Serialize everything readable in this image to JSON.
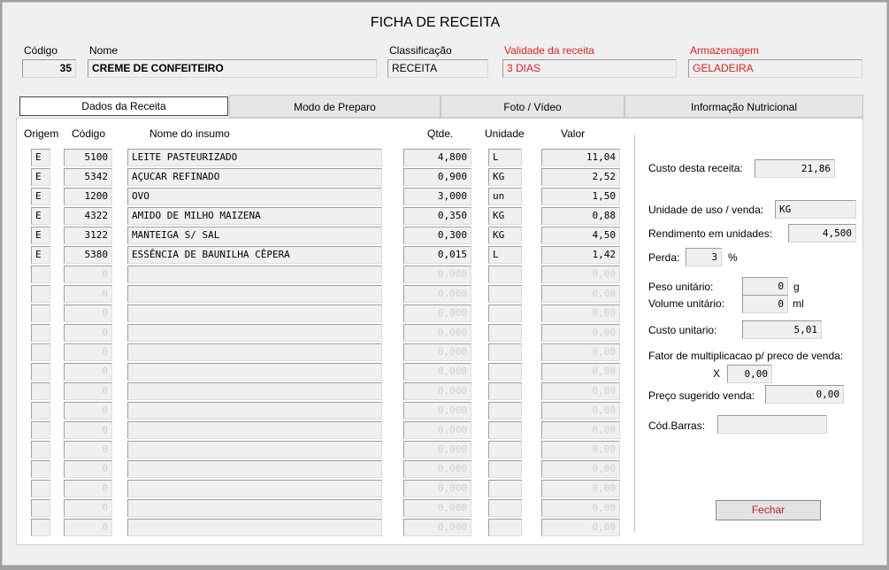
{
  "title": "FICHA DE RECEITA",
  "header": {
    "codigo_label": "Código",
    "codigo_value": "35",
    "nome_label": "Nome",
    "nome_value": "CREME DE CONFEITEIRO",
    "classificacao_label": "Classificação",
    "classificacao_value": "RECEITA",
    "validade_label": "Validade da receita",
    "validade_value": "3 DIAS",
    "armazenagem_label": "Armazenagem",
    "armazenagem_value": "GELADEIRA",
    "accent_color": "#e02020"
  },
  "tabs": [
    {
      "label": "Dados da Receita",
      "active": true
    },
    {
      "label": "Modo de Preparo",
      "active": false
    },
    {
      "label": "Foto / Vídeo",
      "active": false
    },
    {
      "label": "Informação Nutricional",
      "active": false
    }
  ],
  "table": {
    "columns": [
      "Origem",
      "Código",
      "Nome do insumo",
      "Qtde.",
      "Unidade",
      "Valor"
    ],
    "rows": [
      {
        "origem": "E",
        "codigo": "5100",
        "nome": "LEITE PASTEURIZADO",
        "qtde": "4,800",
        "unidade": "L",
        "valor": "11,04"
      },
      {
        "origem": "E",
        "codigo": "5342",
        "nome": "AÇUCAR REFINADO",
        "qtde": "0,900",
        "unidade": "KG",
        "valor": "2,52"
      },
      {
        "origem": "E",
        "codigo": "1200",
        "nome": "OVO",
        "qtde": "3,000",
        "unidade": "un",
        "valor": "1,50"
      },
      {
        "origem": "E",
        "codigo": "4322",
        "nome": "AMIDO DE MILHO MAIZENA",
        "qtde": "0,350",
        "unidade": "KG",
        "valor": "0,88"
      },
      {
        "origem": "E",
        "codigo": "3122",
        "nome": "MANTEIGA S/ SAL",
        "qtde": "0,300",
        "unidade": "KG",
        "valor": "4,50"
      },
      {
        "origem": "E",
        "codigo": "5380",
        "nome": "ESSÊNCIA DE BAUNILHA CÊPERA",
        "qtde": "0,015",
        "unidade": "L",
        "valor": "1,42"
      },
      {
        "origem": "",
        "codigo": "0",
        "nome": "",
        "qtde": "0,000",
        "unidade": "",
        "valor": "0,00"
      },
      {
        "origem": "",
        "codigo": "0",
        "nome": "",
        "qtde": "0,000",
        "unidade": "",
        "valor": "0,00"
      },
      {
        "origem": "",
        "codigo": "0",
        "nome": "",
        "qtde": "0,000",
        "unidade": "",
        "valor": "0,00"
      },
      {
        "origem": "",
        "codigo": "0",
        "nome": "",
        "qtde": "0,000",
        "unidade": "",
        "valor": "0,00"
      },
      {
        "origem": "",
        "codigo": "0",
        "nome": "",
        "qtde": "0,000",
        "unidade": "",
        "valor": "0,00"
      },
      {
        "origem": "",
        "codigo": "0",
        "nome": "",
        "qtde": "0,000",
        "unidade": "",
        "valor": "0,00"
      },
      {
        "origem": "",
        "codigo": "0",
        "nome": "",
        "qtde": "0,000",
        "unidade": "",
        "valor": "0,00"
      },
      {
        "origem": "",
        "codigo": "0",
        "nome": "",
        "qtde": "0,000",
        "unidade": "",
        "valor": "0,00"
      },
      {
        "origem": "",
        "codigo": "0",
        "nome": "",
        "qtde": "0,000",
        "unidade": "",
        "valor": "0,00"
      },
      {
        "origem": "",
        "codigo": "0",
        "nome": "",
        "qtde": "0,000",
        "unidade": "",
        "valor": "0,00"
      },
      {
        "origem": "",
        "codigo": "0",
        "nome": "",
        "qtde": "0,000",
        "unidade": "",
        "valor": "0,00"
      },
      {
        "origem": "",
        "codigo": "0",
        "nome": "",
        "qtde": "0,000",
        "unidade": "",
        "valor": "0,00"
      },
      {
        "origem": "",
        "codigo": "0",
        "nome": "",
        "qtde": "0,000",
        "unidade": "",
        "valor": "0,00"
      },
      {
        "origem": "",
        "codigo": "0",
        "nome": "",
        "qtde": "0,000",
        "unidade": "",
        "valor": "0,00"
      }
    ]
  },
  "summary": {
    "custo_label": "Custo desta receita:",
    "custo_value": "21,86",
    "unidade_label": "Unidade de uso / venda:",
    "unidade_value": "KG",
    "rendimento_label": "Rendimento em unidades:",
    "rendimento_value": "4,500",
    "perda_label": "Perda:",
    "perda_value": "3",
    "perda_unit": "%",
    "peso_label": "Peso unitário:",
    "peso_value": "0",
    "peso_unit": "g",
    "volume_label": "Volume unitário:",
    "volume_value": "0",
    "volume_unit": "ml",
    "custo_unit_label": "Custo unitario:",
    "custo_unit_value": "5,01",
    "fator_label": "Fator de multiplicacao p/ preco de venda:",
    "fator_x": "X",
    "fator_value": "0,00",
    "preco_label": "Preço sugerido venda:",
    "preco_value": "0,00",
    "barras_label": "Cód.Barras:",
    "barras_value": ""
  },
  "buttons": {
    "fechar": "Fechar"
  }
}
